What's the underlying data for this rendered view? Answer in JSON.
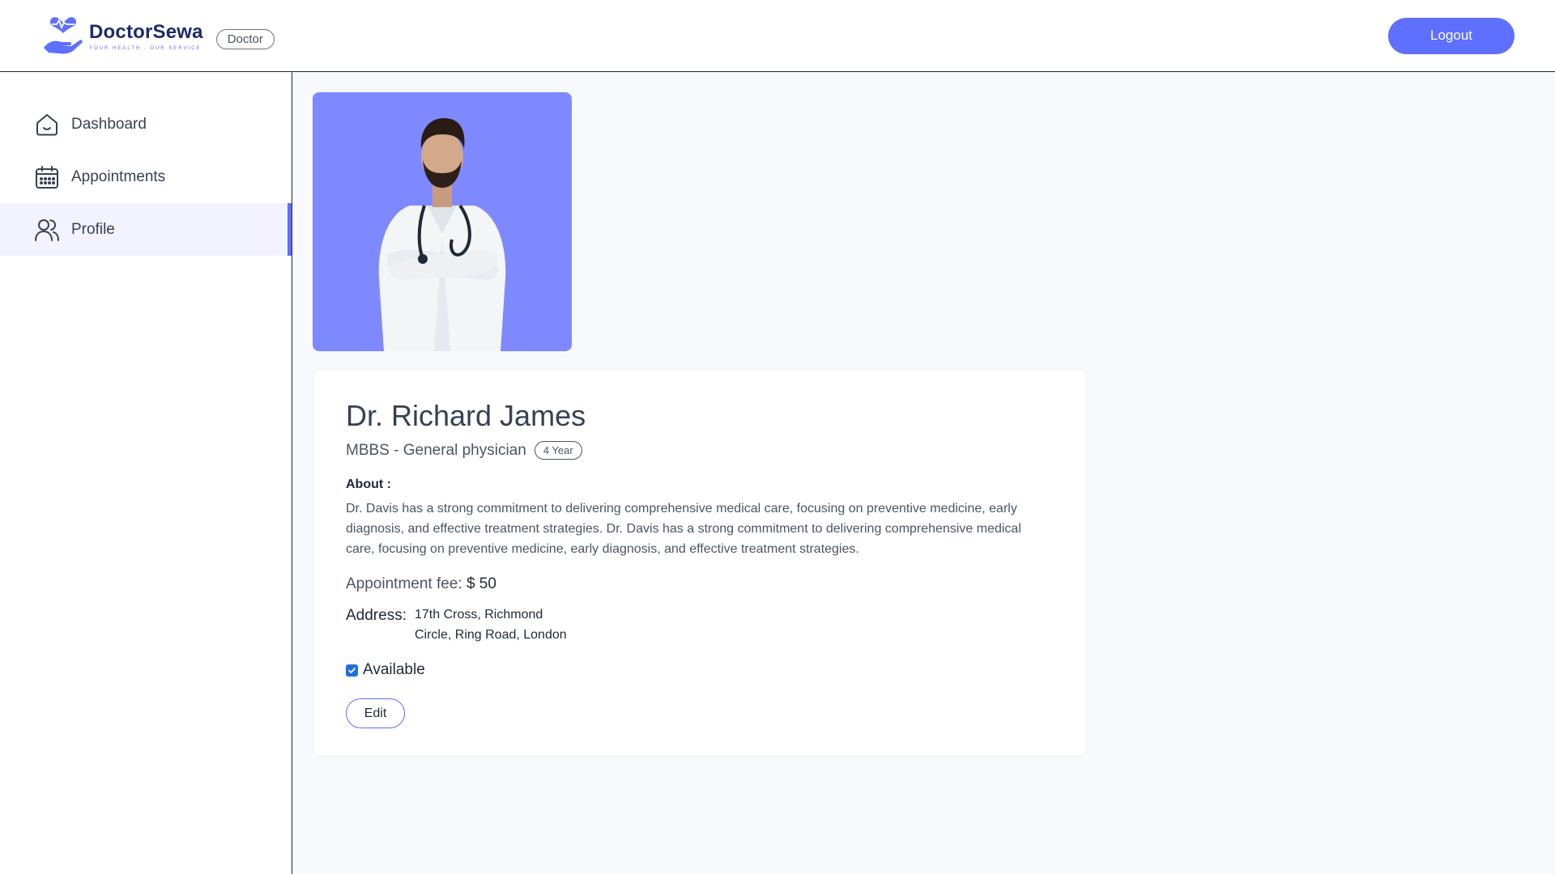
{
  "header": {
    "brand_name": "DoctorSewa",
    "brand_tagline": "YOUR HEALTH . OUR SERVICE",
    "role_badge": "Doctor",
    "logout_label": "Logout",
    "accent_color": "#5f6fff"
  },
  "sidebar": {
    "items": [
      {
        "label": "Dashboard",
        "icon": "home-icon",
        "active": false
      },
      {
        "label": "Appointments",
        "icon": "calendar-icon",
        "active": false
      },
      {
        "label": "Profile",
        "icon": "people-icon",
        "active": true
      }
    ]
  },
  "profile": {
    "photo_alt": "doctor-photo",
    "name": "Dr. Richard James",
    "degree": "MBBS - General physician",
    "experience": "4 Year",
    "about_label": "About :",
    "about_text": "Dr. Davis has a strong commitment to delivering comprehensive medical care, focusing on preventive medicine, early diagnosis, and effective treatment strategies. Dr. Davis has a strong commitment to delivering comprehensive medical care, focusing on preventive medicine, early diagnosis, and effective treatment strategies.",
    "fee_label": "Appointment fee:",
    "fee_value": "$ 50",
    "address_label": "Address:",
    "address_line1": "17th Cross, Richmond",
    "address_line2": "Circle, Ring Road, London",
    "available_label": "Available",
    "available": true,
    "edit_label": "Edit"
  }
}
